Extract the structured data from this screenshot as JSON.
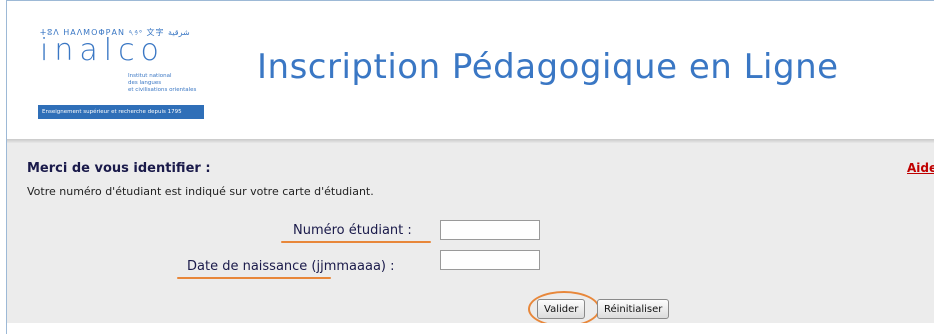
{
  "header": {
    "logo": {
      "scripts_line": "ⵜⵓⴷ ΗΑΛΜΟΦΡΑΝ 𐤏𐤁𐤓 文字 شرقية",
      "word": "inalco",
      "subtitle_lines": [
        "Institut national",
        "des langues",
        "et civilisations orientales"
      ],
      "band_text": "Enseignement supérieur et recherche depuis 1795"
    },
    "title": "Inscription Pédagogique en Ligne"
  },
  "panel": {
    "heading": "Merci de vous identifier :",
    "help_link": "Aide",
    "instruction": "Votre numéro d'étudiant est indiqué sur votre carte d'étudiant.",
    "fields": {
      "student_number_label": "Numéro étudiant :",
      "student_number_value": "",
      "birth_date_label": "Date de naissance (jjmmaaaa) :",
      "birth_date_value": ""
    },
    "buttons": {
      "submit": "Valider",
      "reset": "Réinitialiser"
    }
  },
  "colors": {
    "brand_blue": "#3a77c4",
    "highlight_orange": "#e8873a",
    "help_red": "#c00000",
    "panel_bg": "#ececec"
  }
}
